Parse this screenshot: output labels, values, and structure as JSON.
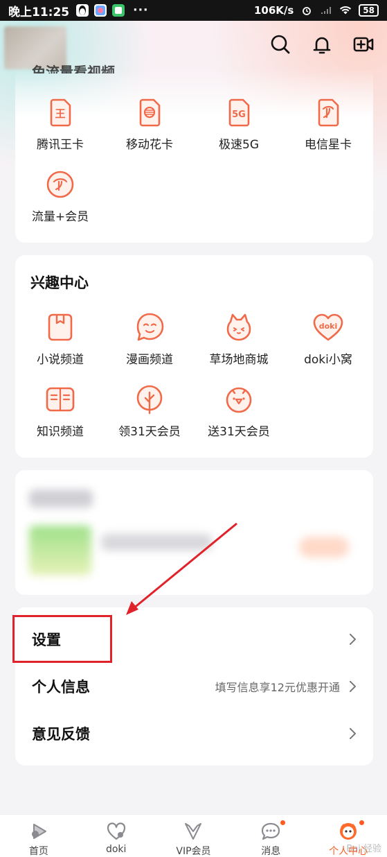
{
  "status_bar": {
    "time": "晚上11:25",
    "dots": "···",
    "network_speed": "106K/s",
    "battery": "58"
  },
  "card_flow": {
    "title_partial": "免流量看视频",
    "items": [
      {
        "label": "腾讯王卡",
        "icon": "tencent-king-card-icon",
        "glyph": "王"
      },
      {
        "label": "移动花卡",
        "icon": "mobile-flower-card-icon",
        "glyph": ""
      },
      {
        "label": "极速5G",
        "icon": "5g-sim-icon",
        "glyph": "5G"
      },
      {
        "label": "电信星卡",
        "icon": "telecom-star-card-icon",
        "glyph": ""
      },
      {
        "label": "流量+会员",
        "icon": "data-plus-member-icon",
        "glyph": ""
      }
    ]
  },
  "card_interest": {
    "title": "兴趣中心",
    "items": [
      {
        "label": "小说频道",
        "icon": "novel-channel-icon"
      },
      {
        "label": "漫画频道",
        "icon": "comic-channel-icon"
      },
      {
        "label": "草场地商城",
        "icon": "grassland-mall-icon"
      },
      {
        "label": "doki小窝",
        "icon": "doki-nest-icon",
        "glyph": "doki"
      },
      {
        "label": "知识频道",
        "icon": "knowledge-channel-icon"
      },
      {
        "label": "领31天会员",
        "icon": "claim-31-day-member-icon"
      },
      {
        "label": "送31天会员",
        "icon": "gift-31-day-member-icon"
      }
    ]
  },
  "settings_list": {
    "rows": [
      {
        "label": "设置",
        "hint": ""
      },
      {
        "label": "个人信息",
        "hint": "填写信息享12元优惠开通"
      },
      {
        "label": "意见反馈",
        "hint": ""
      }
    ]
  },
  "bottom_nav": {
    "items": [
      {
        "label": "首页",
        "icon": "home-play-icon"
      },
      {
        "label": "doki",
        "icon": "doki-heart-icon"
      },
      {
        "label": "VIP会员",
        "icon": "vip-crown-icon"
      },
      {
        "label": "消息",
        "icon": "message-bubble-icon"
      },
      {
        "label": "个人中心",
        "icon": "profile-mascot-icon"
      }
    ]
  },
  "watermark": "Bai 经验",
  "colors": {
    "accent": "#ff5a1f",
    "icon_stroke": "#f06a4a",
    "highlight": "#e0222b"
  }
}
